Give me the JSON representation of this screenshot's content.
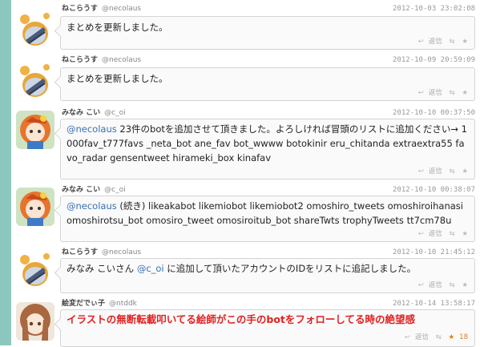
{
  "tweets": [
    {
      "display_name": "ねこらうす",
      "screen_name": "@necolaus",
      "date": "2012-10-03 23:02:08",
      "text": "まとめを更新しました。",
      "reply": "返信",
      "avatar": "necolaus-avatar"
    },
    {
      "display_name": "ねこらうす",
      "screen_name": "@necolaus",
      "date": "2012-10-09 20:59:09",
      "text": "まとめを更新しました。",
      "reply": "返信",
      "avatar": "necolaus-avatar"
    },
    {
      "display_name": "みなみ こい",
      "screen_name": "@c_oi",
      "date": "2012-10-10 00:37:50",
      "mention": "@necolaus",
      "text": " 23件のbotを追加させて頂きました。よろしければ冒頭のリストに追加ください→ 1000fav_t777favs _neta_bot ane_fav bot_wwww botokinir eru_chitanda extraextra55 favo_radar gensentweet hirameki_box kinafav",
      "reply": "返信",
      "avatar": "c_oi-avatar"
    },
    {
      "display_name": "みなみ こい",
      "screen_name": "@c_oi",
      "date": "2012-10-10 00:38:07",
      "mention": "@necolaus",
      "text": " (続き) likeakabot likemiobot likemiobot2 omoshiro_tweets omoshiroihanasi omoshirotsu_bot omosiro_tweet omosiroitub_bot shareTwts trophyTweets tt7cm78u",
      "reply": "返信",
      "avatar": "c_oi-avatar"
    },
    {
      "display_name": "ねこらうす",
      "screen_name": "@necolaus",
      "date": "2012-10-10 21:45:12",
      "text_pre": "みなみ こいさん ",
      "mention": "@c_oi",
      "text": " に追加して頂いたアカウントのIDをリストに追記しました。",
      "reply": "返信",
      "avatar": "necolaus-avatar"
    },
    {
      "display_name": "絵変だでぃ子",
      "screen_name": "@ntddk",
      "date": "2012-10-14 13:58:17",
      "text_a": "イラストの無断転載叩いてる絵師がこの手の",
      "text_b": "bot",
      "text_c": "をフォローしてる時の絶望感",
      "reply": "返信",
      "fav_count": "18",
      "avatar": "ntddk-avatar"
    }
  ],
  "colors": {
    "sidebar": "#8cc7bd",
    "mention": "#3a6fb3",
    "headline": "#e02222",
    "fav": "#e07b1a"
  }
}
